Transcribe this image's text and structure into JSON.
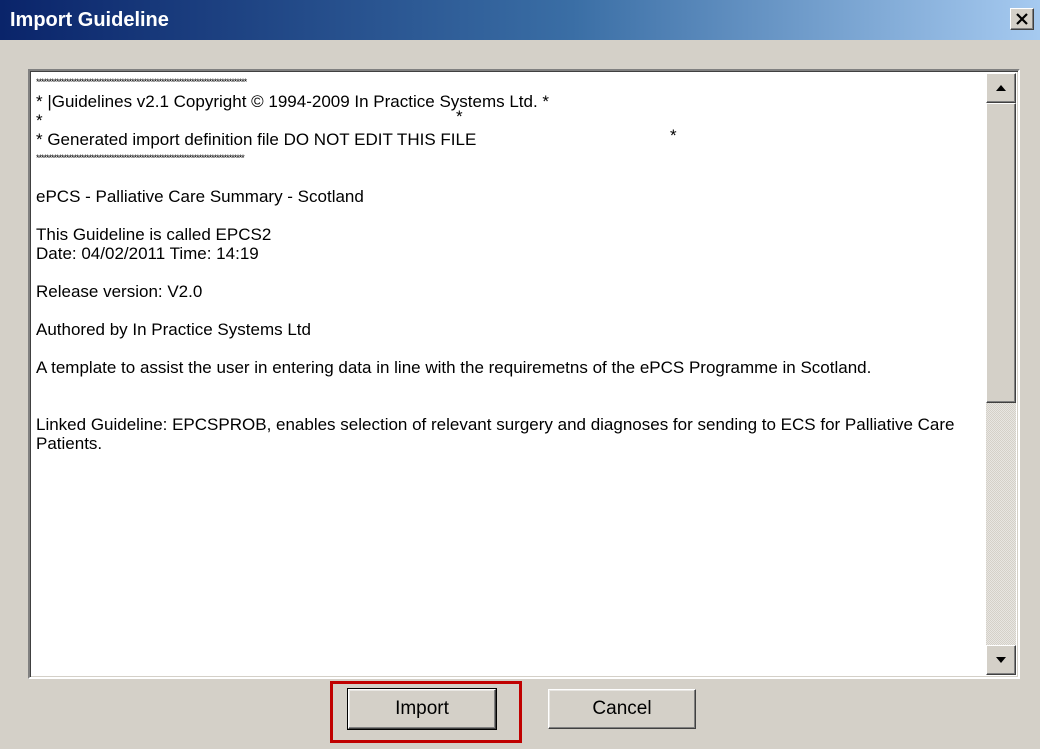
{
  "window": {
    "title": "Import Guideline",
    "close_glyph": "X"
  },
  "content": {
    "star_line_1": "************************************************************************************",
    "line_1": "* |Guidelines v2.1   Copyright © 1994-2009 In Practice Systems Ltd. *",
    "line_2_left": "*",
    "line_2_right": "*",
    "line_3_left": "* Generated import definition file   DO NOT EDIT THIS FILE",
    "line_3_right": "*",
    "star_line_2": "***********************************************************************************",
    "title_line": "ePCS - Palliative Care Summary - Scotland",
    "called_line": "This Guideline is called EPCS2",
    "date_line": "Date: 04/02/2011 Time: 14:19",
    "release_line": "Release version: V2.0",
    "author_line": "Authored by In Practice Systems Ltd",
    "template_para": "A template to assist the user in entering data in line with the requiremetns of the ePCS Programme in Scotland.",
    "linked_para": "Linked Guideline: EPCSPROB, enables selection of relevant surgery and diagnoses for sending to ECS for Palliative Care Patients."
  },
  "buttons": {
    "import_label": "Import",
    "cancel_label": "Cancel"
  },
  "colors": {
    "titlebar_start": "#0a246a",
    "titlebar_end": "#a6caf0",
    "face": "#d4d0c8",
    "highlight": "#c00000"
  },
  "icons": {
    "close": "close-icon",
    "scroll_up": "arrow-up-icon",
    "scroll_down": "arrow-down-icon"
  }
}
